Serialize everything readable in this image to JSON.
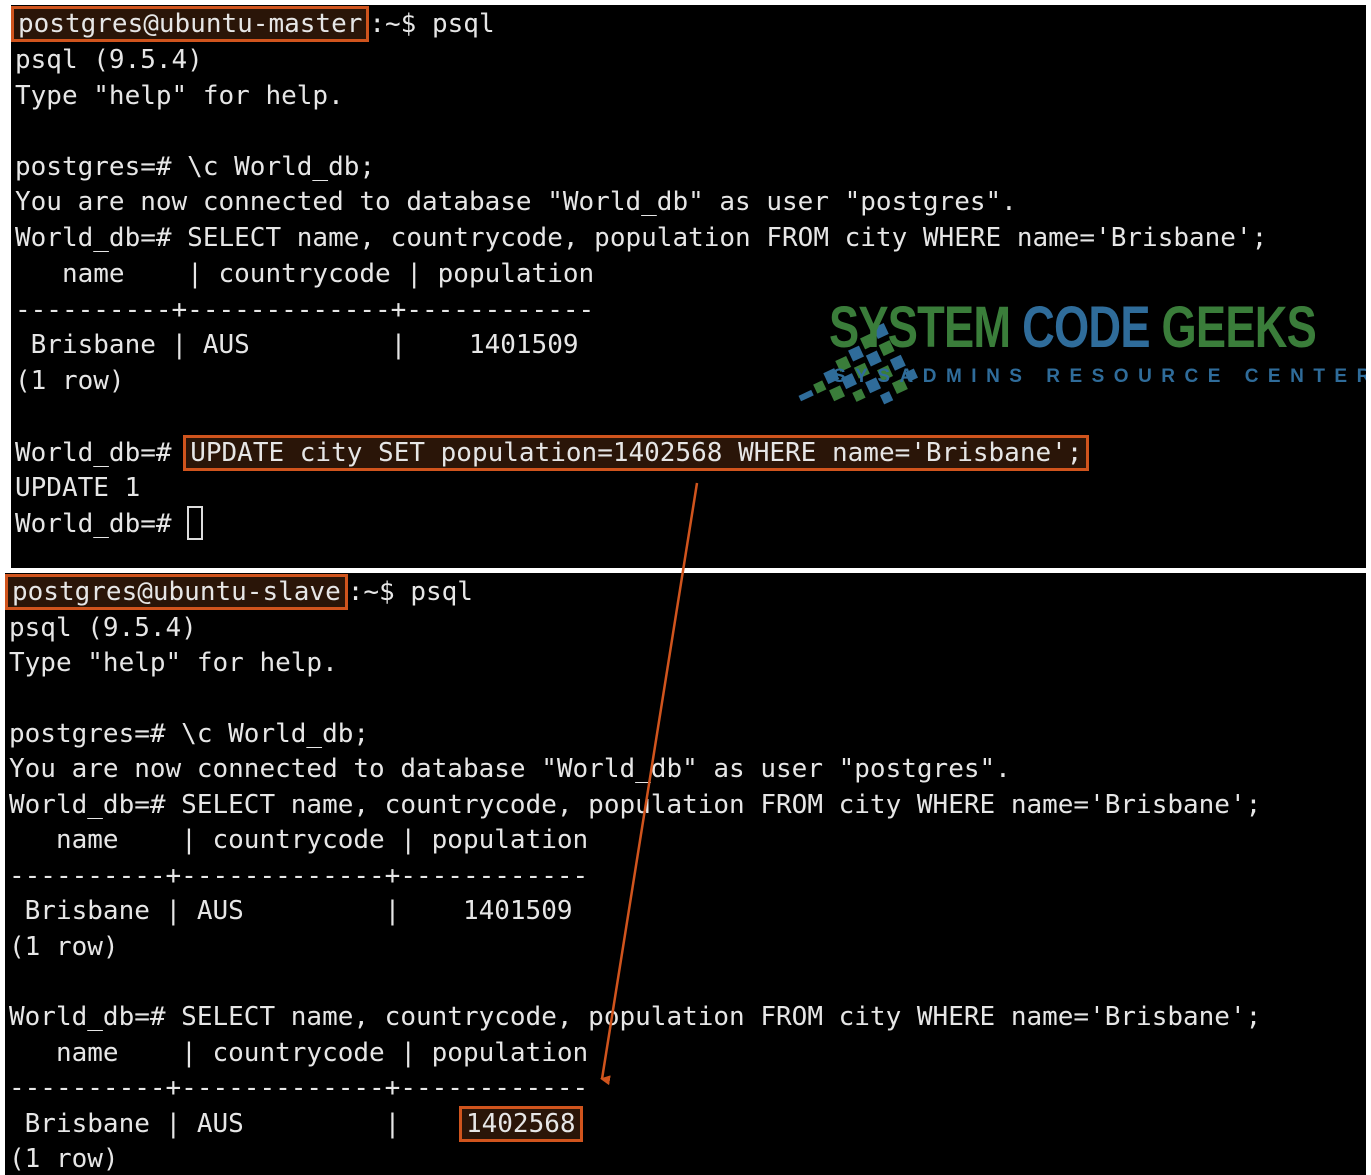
{
  "accent_color": "#d0541d",
  "master": {
    "prompt_user_host": "postgres@ubuntu-master",
    "prompt_rest": ":~$ psql",
    "version_line": "psql (9.5.4)",
    "help_line": "Type \"help\" for help.",
    "connect_cmd": "postgres=# \\c World_db;",
    "connected_msg": "You are now connected to database \"World_db\" as user \"postgres\".",
    "select_cmd": "World_db=# SELECT name, countrycode, population FROM city WHERE name='Brisbane';",
    "table_header": "   name    | countrycode | population",
    "table_sep": "----------+-------------+------------",
    "table_row": " Brisbane | AUS         |    1401509",
    "row_count": "(1 row)",
    "update_prompt": "World_db=#",
    "update_cmd": "UPDATE city SET population=1402568 WHERE name='Brisbane';",
    "update_result": "UPDATE 1",
    "final_prompt": "World_db=#"
  },
  "slave": {
    "prompt_user_host": "postgres@ubuntu-slave",
    "prompt_rest": ":~$ psql",
    "version_line": "psql (9.5.4)",
    "help_line": "Type \"help\" for help.",
    "connect_cmd": "postgres=# \\c World_db;",
    "connected_msg": "You are now connected to database \"World_db\" as user \"postgres\".",
    "select_cmd_1": "World_db=# SELECT name, countrycode, population FROM city WHERE name='Brisbane';",
    "table_header_1": "   name    | countrycode | population",
    "table_sep_1": "----------+-------------+------------",
    "table_row_1": " Brisbane | AUS         |    1401509",
    "row_count_1": "(1 row)",
    "select_cmd_2": "World_db=# SELECT name, countrycode, population FROM city WHERE name='Brisbane';",
    "table_header_2": "   name    | countrycode | population",
    "table_sep_2": "----------+-------------+------------",
    "table_row_2_prefix": " Brisbane | AUS         |    ",
    "table_row_2_value": "1402568",
    "row_count_2": "(1 row)"
  },
  "logo": {
    "title_green": "SYSTEM ",
    "title_blue": "CODE ",
    "title_green2": "GEEKS",
    "subtitle": "SYSADMINS RESOURCE CENTER",
    "green": "#3a7d3a",
    "blue": "#2f6c9a"
  }
}
